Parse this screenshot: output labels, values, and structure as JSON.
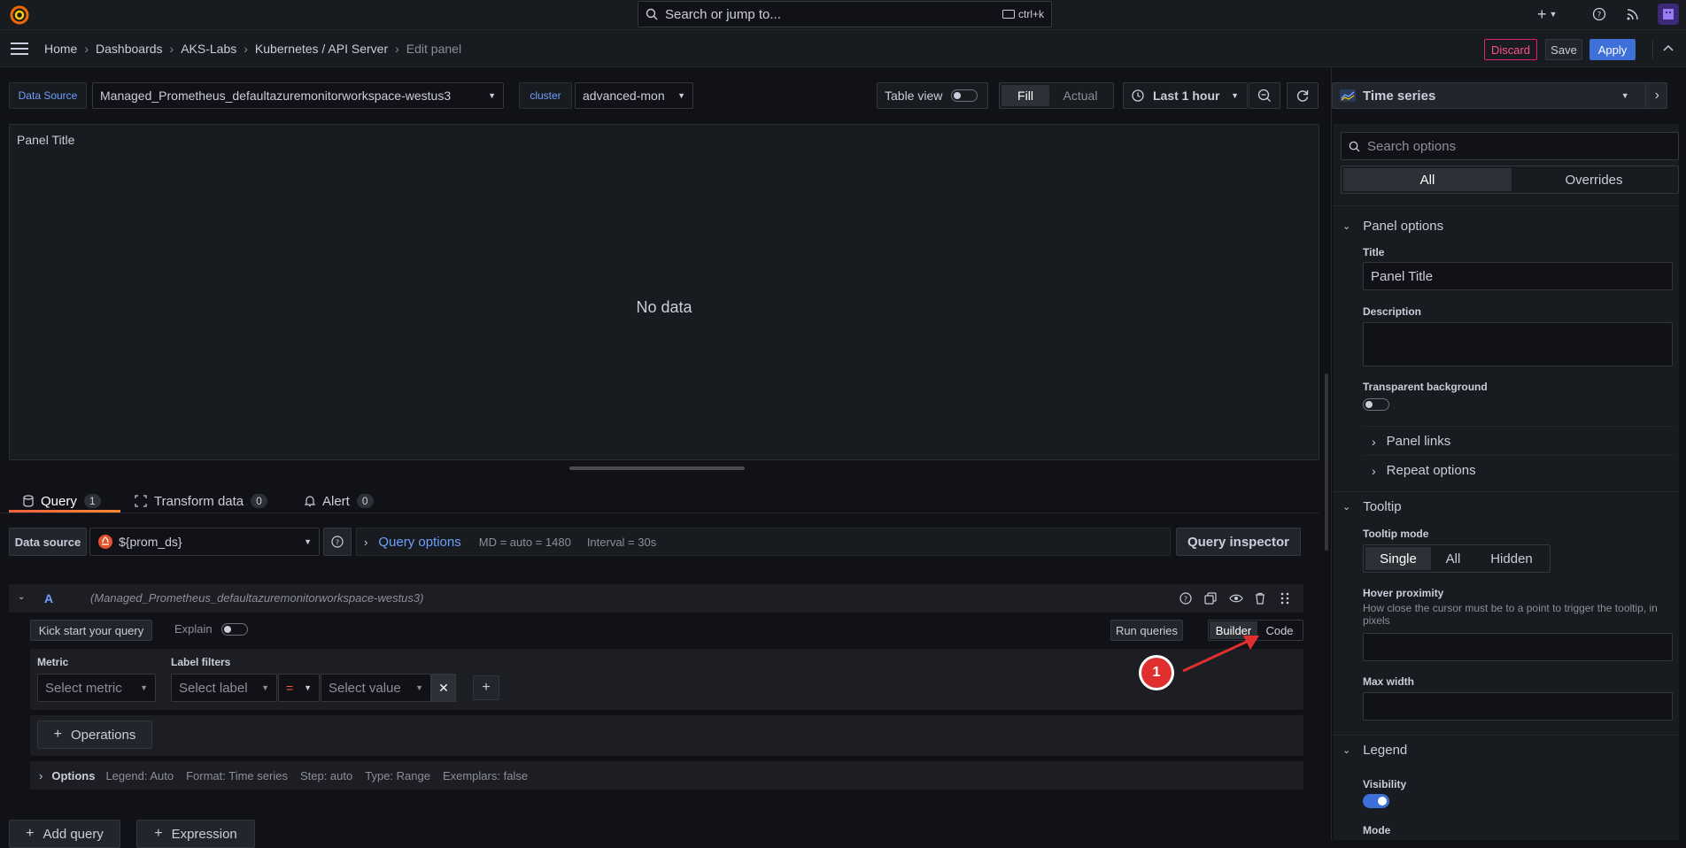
{
  "topbar": {
    "search_placeholder": "Search or jump to...",
    "search_shortcut": "ctrl+k"
  },
  "breadcrumb": {
    "items": [
      "Home",
      "Dashboards",
      "AKS-Labs",
      "Kubernetes / API Server"
    ],
    "current": "Edit panel"
  },
  "actions": {
    "discard": "Discard",
    "save": "Save",
    "apply": "Apply"
  },
  "toolbar": {
    "datasource_label": "Data Source",
    "datasource_value": "Managed_Prometheus_defaultazuremonitorworkspace-westus3",
    "cluster_label": "cluster",
    "cluster_value": "advanced-mon",
    "table_view": "Table view",
    "fill": "Fill",
    "actual": "Actual",
    "time_range": "Last 1 hour"
  },
  "panel": {
    "title": "Panel Title",
    "no_data": "No data"
  },
  "tabs": [
    {
      "label": "Query",
      "count": "1"
    },
    {
      "label": "Transform data",
      "count": "0"
    },
    {
      "label": "Alert",
      "count": "0"
    }
  ],
  "query": {
    "ds_label": "Data source",
    "ds_value": "${prom_ds}",
    "options_label": "Query options",
    "md": "MD = auto = 1480",
    "interval": "Interval = 30s",
    "inspector": "Query inspector",
    "row_letter": "A",
    "row_ds": "(Managed_Prometheus_defaultazuremonitorworkspace-westus3)",
    "kickstart": "Kick start your query",
    "explain": "Explain",
    "run": "Run queries",
    "builder": "Builder",
    "code": "Code",
    "metric_label": "Metric",
    "metric_placeholder": "Select metric",
    "label_filters": "Label filters",
    "select_label": "Select label",
    "operator": "=",
    "select_value": "Select value",
    "operations": "Operations",
    "options": "Options",
    "legend": "Legend: Auto",
    "format": "Format: Time series",
    "step": "Step: auto",
    "type": "Type: Range",
    "exemplars": "Exemplars: false",
    "add_query": "Add query",
    "expression": "Expression"
  },
  "annotation": {
    "number": "1"
  },
  "sidebar": {
    "viz": "Time series",
    "search_placeholder": "Search options",
    "all": "All",
    "overrides": "Overrides",
    "panel_options": "Panel options",
    "title_label": "Title",
    "title_value": "Panel Title",
    "description_label": "Description",
    "transparent_label": "Transparent background",
    "panel_links": "Panel links",
    "repeat_options": "Repeat options",
    "tooltip": "Tooltip",
    "tooltip_mode": "Tooltip mode",
    "mode_single": "Single",
    "mode_all": "All",
    "mode_hidden": "Hidden",
    "hover_proximity": "Hover proximity",
    "hover_desc": "How close the cursor must be to a point to trigger the tooltip, in pixels",
    "max_width": "Max width",
    "legend": "Legend",
    "visibility": "Visibility",
    "mode": "Mode"
  },
  "colors": {
    "accent": "#3d71d9",
    "discard": "#e0226e",
    "annotation": "#e02f2f",
    "orange": "#f55f3e"
  }
}
